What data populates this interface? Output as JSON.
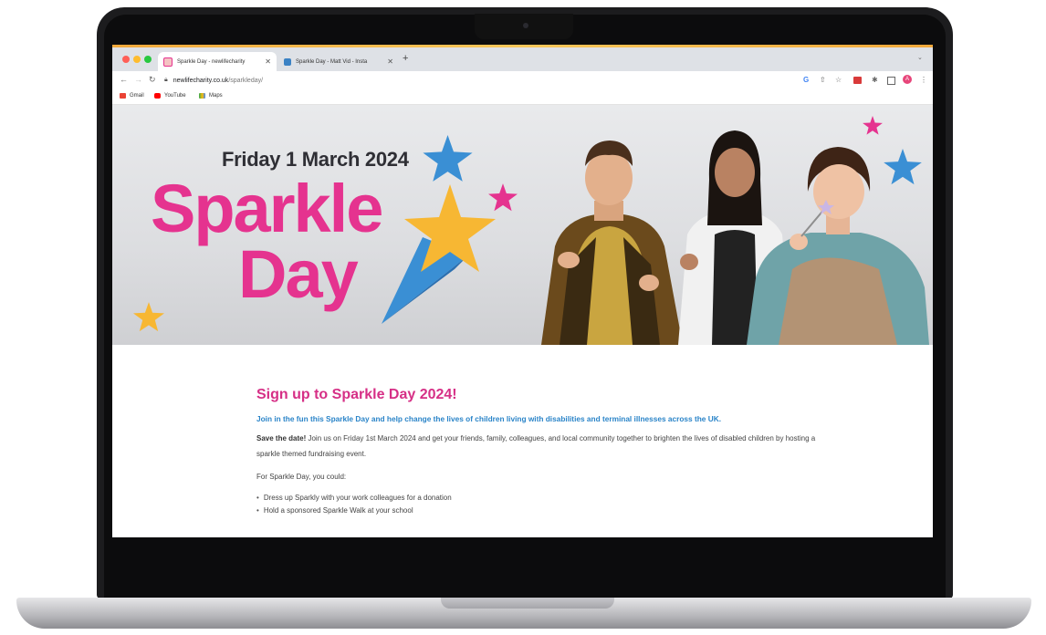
{
  "browser": {
    "tabs": [
      {
        "label": "Sparkle Day - newlifecharity",
        "active": true
      },
      {
        "label": "Sparkle Day - Matt Vid - Insta",
        "active": false
      }
    ],
    "new_tab_icon": "plus-icon",
    "url_host": "newlifecharity.co.uk",
    "url_path": "/sparkleday/",
    "bookmarks": [
      "Gmail",
      "YouTube",
      "Maps"
    ],
    "profile_initial": "A"
  },
  "hero": {
    "date": "Friday 1 March 2024",
    "title_line1": "Sparkle",
    "title_line2": "Day"
  },
  "content": {
    "heading": "Sign up to Sparkle Day 2024!",
    "lead": "Join in the fun this Sparkle Day and help change the lives of children living with disabilities and terminal illnesses across the UK.",
    "save_bold": "Save the date!",
    "save_text": " Join us on Friday 1st March 2024 and get your friends, family, colleagues, and local community together to brighten the lives of disabled children by hosting a sparkle themed fundraising event.",
    "could_intro": "For Sparkle Day, you could:",
    "ideas": [
      "Dress up Sparkly with your work colleagues for a donation",
      "Hold a sponsored Sparkle Walk at your school"
    ]
  },
  "colors": {
    "brand_pink": "#e5338f",
    "heading_pink": "#d62f86",
    "lead_blue": "#2a84c8",
    "star_blue": "#3a8fd4",
    "star_yellow": "#f7b733"
  }
}
